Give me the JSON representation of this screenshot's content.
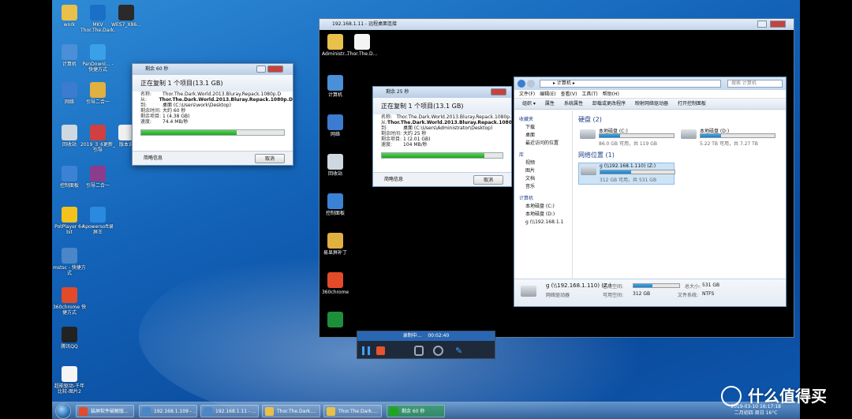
{
  "desktop": {
    "icons": [
      {
        "label": "work",
        "color": "#e8c04a"
      },
      {
        "label": "MKV Thor.The.Dark.",
        "color": "#1a6fc7"
      },
      {
        "label": "WES7_X86...",
        "color": "#2a2a2a"
      },
      {
        "label": "计算机",
        "color": "#4a8fd8"
      },
      {
        "label": "PanDownl... - 快捷方式",
        "color": "#3aa0e8"
      },
      {
        "label": "网络",
        "color": "#3b7bd0"
      },
      {
        "label": "引导二合一",
        "color": "#e0b040"
      },
      {
        "label": "回收站",
        "color": "#cfd8e0"
      },
      {
        "label": "2019_3_6更新_引导",
        "color": "#d04040"
      },
      {
        "label": "版本说",
        "color": "#f0f0f0"
      },
      {
        "label": "控制面板",
        "color": "#3c82d4"
      },
      {
        "label": "引导二合一",
        "color": "#8c3c8c"
      },
      {
        "label": "PotPlayer 64 bit",
        "color": "#f3c21c"
      },
      {
        "label": "Apowersoft录屏王",
        "color": "#2a8ae0"
      },
      {
        "label": "mstsc - 快捷方式",
        "color": "#4a86c8"
      },
      {
        "label": "360chrome 快捷方式",
        "color": "#e24a2a"
      },
      {
        "label": "腾讯QQ",
        "color": "#222"
      },
      {
        "label": "超能驱动-千年比较-图片2",
        "color": "#f5f5f5"
      }
    ]
  },
  "local_copy": {
    "title": "剩余 60 秒",
    "heading": "正在复制 1 个项目(13.1 GB)",
    "rows": [
      {
        "k": "名称:",
        "v": "Thor.The.Dark.World.2013.Bluray.Repack.1080p.D"
      },
      {
        "k": "从:",
        "v": "Thor.The.Dark.World.2013.Bluray.Repack.1080p.D"
      },
      {
        "k": "到:",
        "v": "桌面 (C:\\Users\\work\\Desktop)"
      },
      {
        "k": "剩余时间:",
        "v": "大约 60 秒"
      },
      {
        "k": "剩余项目:",
        "v": "1 (4.38 GB)"
      },
      {
        "k": "速度:",
        "v": "74.4 MB/秒"
      }
    ],
    "progress": 0.67,
    "more": "简略信息",
    "cancel": "取消"
  },
  "remote": {
    "title": "192.168.1.11 - 远程桌面连接",
    "icons": [
      {
        "label": "Administr...",
        "color": "#e8c04a"
      },
      {
        "label": "Thor.The.D...",
        "color": "#f4f4f4"
      },
      {
        "label": "计算机",
        "color": "#4a8fd8"
      },
      {
        "label": "网络",
        "color": "#3b7bd0"
      },
      {
        "label": "回收站",
        "color": "#cfd8e0"
      },
      {
        "label": "控制面板",
        "color": "#3c82d4"
      },
      {
        "label": "易显屏补丁",
        "color": "#e0b040"
      },
      {
        "label": "360chrome",
        "color": "#e24a2a"
      },
      {
        "label": "",
        "color": "#1d8f3a"
      }
    ],
    "copy": {
      "title": "剩余 25 秒",
      "heading": "正在复制 1 个项目(13.1 GB)",
      "rows": [
        {
          "k": "名称:",
          "v": "Thor.The.Dark.World.2013.Bluray.Repack.1080p."
        },
        {
          "k": "从:",
          "v": "Thor.The.Dark.World.2013.Bluray.Repack.1080p."
        },
        {
          "k": "到:",
          "v": "桌面 (C:\\Users\\Administrator\\Desktop)"
        },
        {
          "k": "剩余时间:",
          "v": "大约 25 秒"
        },
        {
          "k": "剩余项目:",
          "v": "1 (2.01 GB)"
        },
        {
          "k": "速度:",
          "v": "104 MB/秒"
        }
      ],
      "progress": 0.85,
      "more": "简略信息",
      "cancel": "取消"
    },
    "explorer": {
      "address": "▸ 计算机 ▸",
      "search_placeholder": "搜索 计算机",
      "menu": [
        "文件(F)",
        "编辑(E)",
        "查看(V)",
        "工具(T)",
        "帮助(H)"
      ],
      "commands": [
        "组织 ▾",
        "属性",
        "系统属性",
        "卸载或更改程序",
        "映射网络驱动器",
        "打开控制面板"
      ],
      "nav": [
        {
          "label": "收藏夹",
          "group": true
        },
        {
          "label": "下载",
          "group": false
        },
        {
          "label": "桌面",
          "group": false
        },
        {
          "label": "最近访问的位置",
          "group": false
        },
        {
          "label": "库",
          "group": true
        },
        {
          "label": "视频",
          "group": false
        },
        {
          "label": "图片",
          "group": false
        },
        {
          "label": "文档",
          "group": false
        },
        {
          "label": "音乐",
          "group": false
        },
        {
          "label": "计算机",
          "group": true
        },
        {
          "label": "本地磁盘 (C:)",
          "group": false
        },
        {
          "label": "本地磁盘 (D:)",
          "group": false
        },
        {
          "label": "g (\\\\192.168.1.1",
          "group": false
        }
      ],
      "sec_disks": "硬盘 (2)",
      "sec_net": "网络位置 (1)",
      "drives": [
        {
          "name": "本地磁盘 (C:)",
          "size": "86.0 GB 可用，共 119 GB",
          "used": 0.28
        },
        {
          "name": "本地磁盘 (D:)",
          "size": "5.22 TB 可用，共 7.27 TB",
          "used": 0.28
        }
      ],
      "net_drive": {
        "name": "g (\\\\192.168.1.110) (Z:)",
        "size": "312 GB 可用，共 531 GB",
        "used": 0.41
      },
      "details": {
        "name": "g (\\\\192.168.1.110) (Z:)",
        "type": "网络驱动器",
        "used_label": "已用空间:",
        "free_label": "可用空间:",
        "free": "312 GB",
        "total_label": "总大小:",
        "total": "531 GB",
        "fs_label": "文件系统:",
        "fs": "NTFS"
      }
    }
  },
  "recorder": {
    "status": "录制中...",
    "time": "00:02:40"
  },
  "taskbar": {
    "tasks": [
      {
        "label": "装屏软件破解版...",
        "color": "#e24a2a"
      },
      {
        "label": "192.168.1.109 - ...",
        "color": "#4a86c8"
      },
      {
        "label": "192.168.1.11 - ...",
        "color": "#4a86c8"
      },
      {
        "label": "Thor.The.Dark....",
        "color": "#e8c04a"
      },
      {
        "label": "Thor.The.Dark....",
        "color": "#e8c04a"
      },
      {
        "label": "剩余 60 秒",
        "color": "#1ea51e"
      }
    ],
    "date": "2019-03-10",
    "time": "16:17:18",
    "lunar": "二月初四 周日 16°C"
  },
  "watermark": "什么值得买"
}
